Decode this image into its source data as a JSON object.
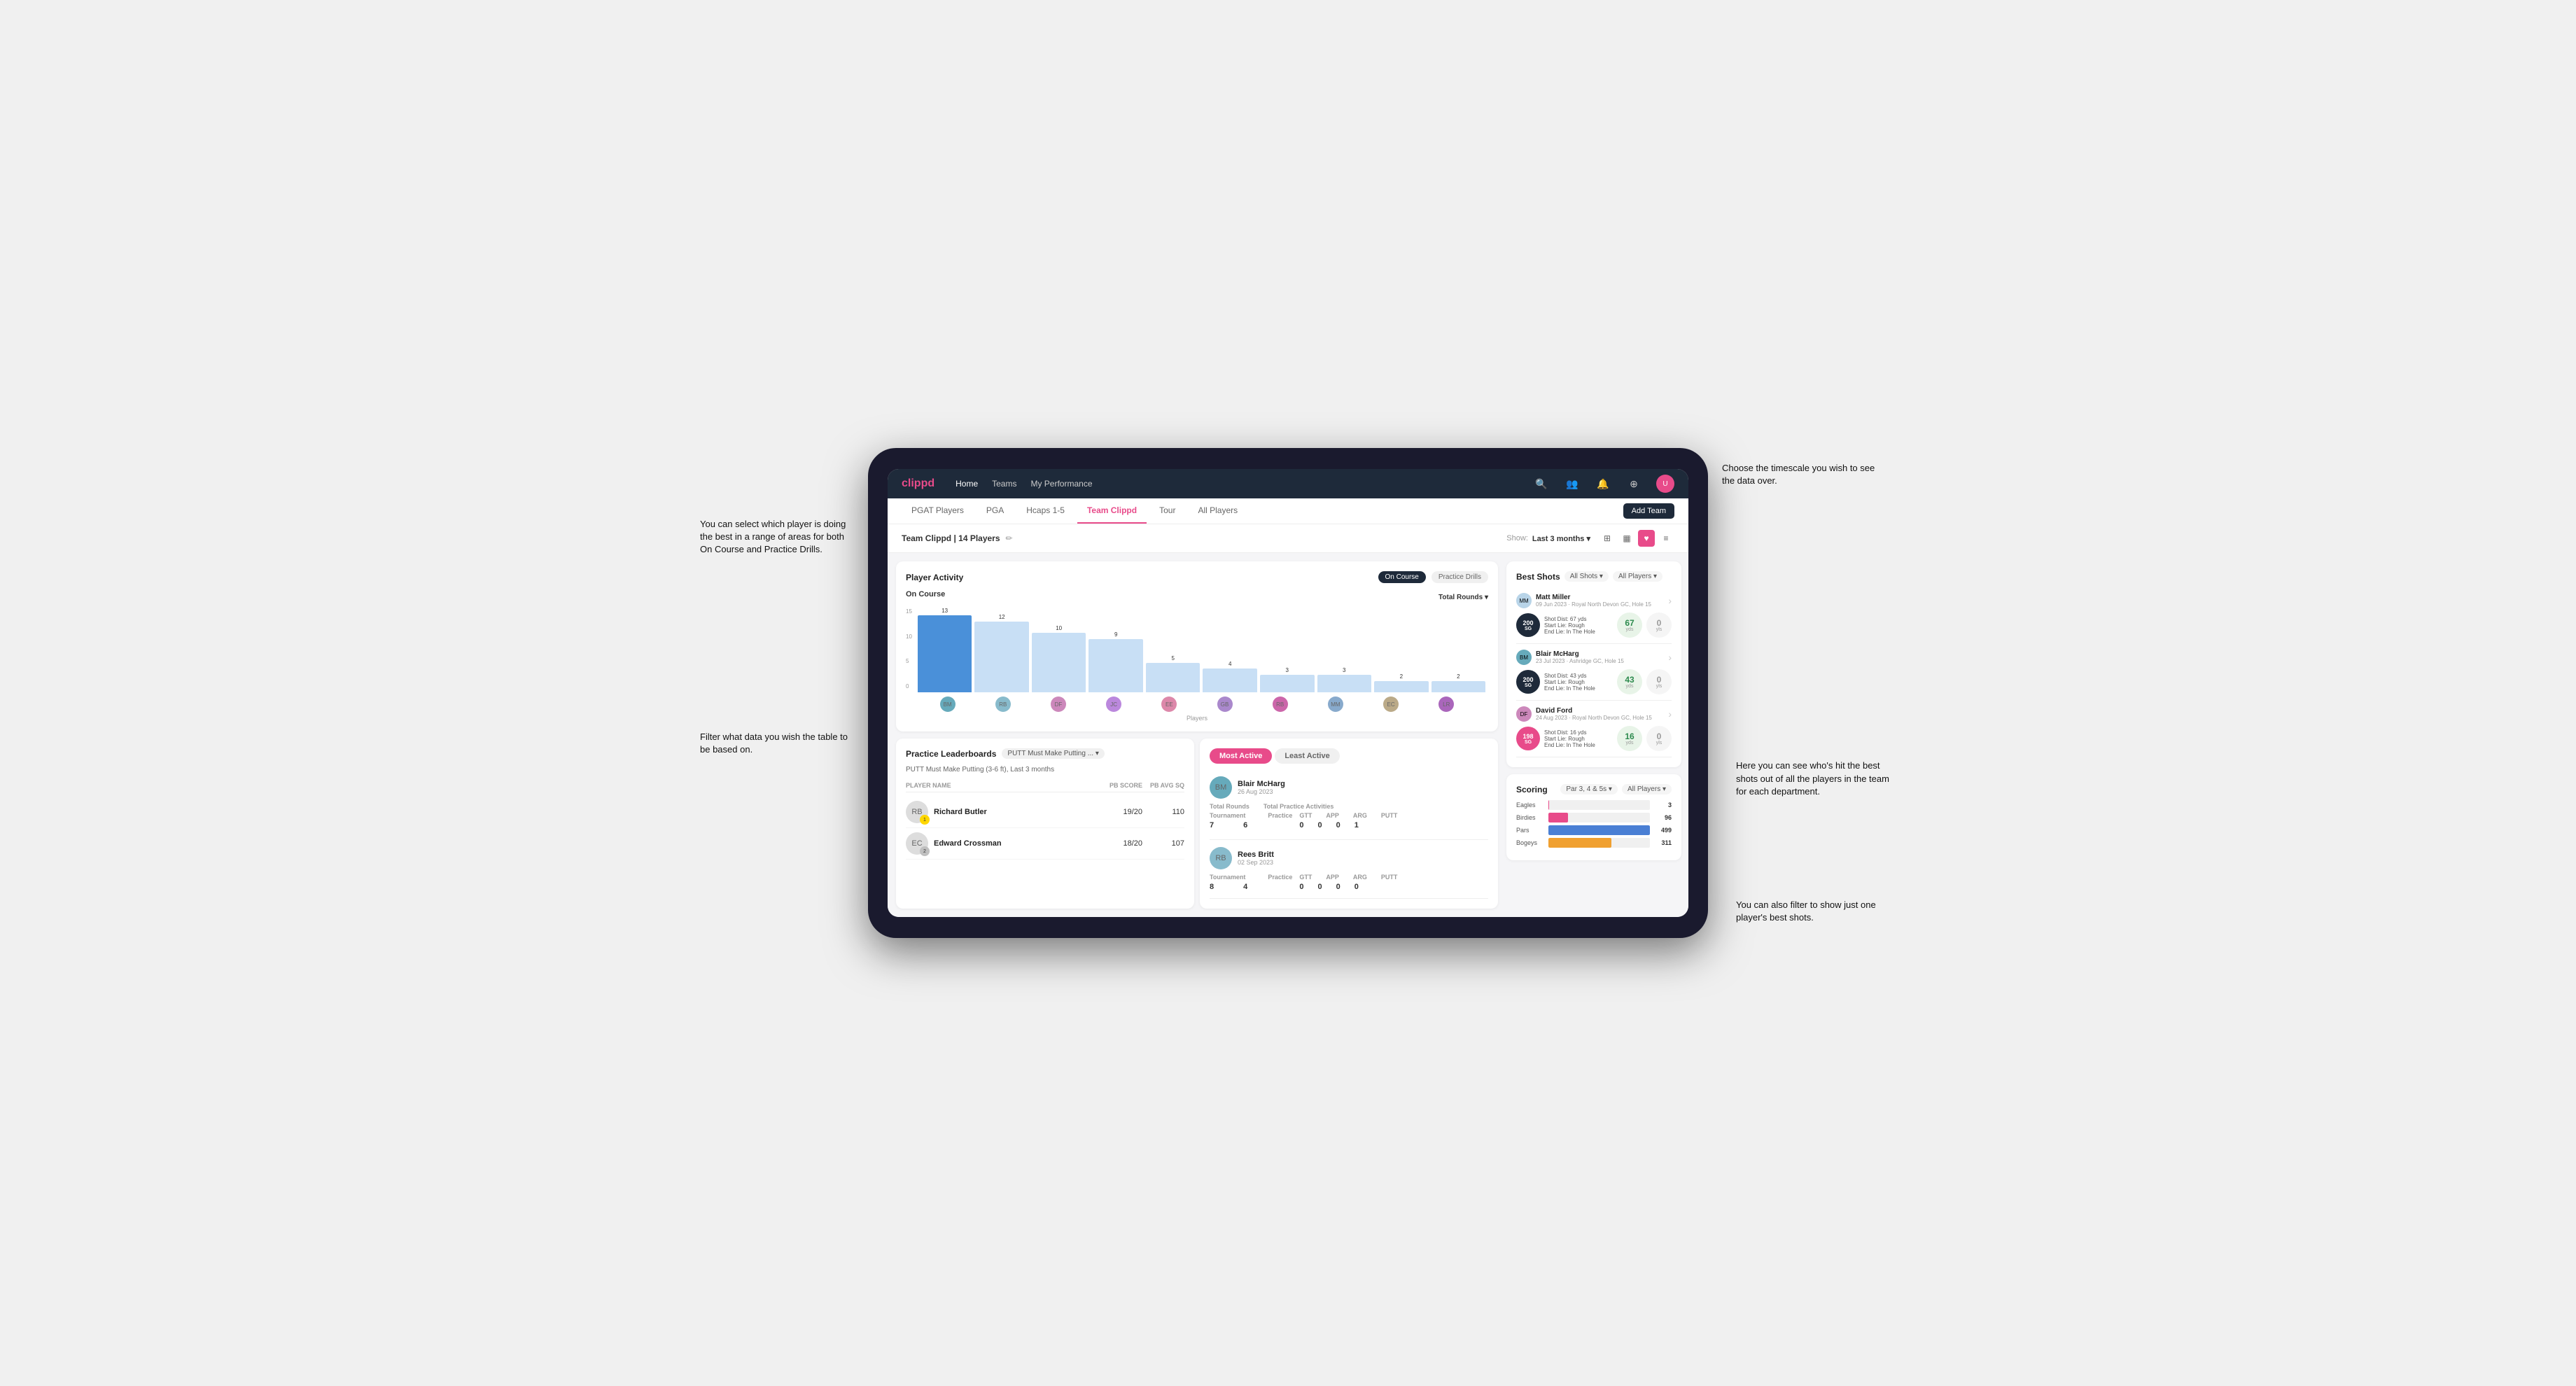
{
  "annotations": {
    "top_right": "Choose the timescale you\nwish to see the data over.",
    "mid_right": "Here you can see who's hit\nthe best shots out of all the\nplayers in the team for\neach department.",
    "bot_right": "You can also filter to show\njust one player's best shots.",
    "top_left": "You can select which player is\ndoing the best in a range of\nareas for both On Course and\nPractice Drills.",
    "bot_left": "Filter what data you wish the\ntable to be based on."
  },
  "nav": {
    "logo": "clippd",
    "links": [
      "Home",
      "Teams",
      "My Performance"
    ],
    "icons": [
      "search",
      "people",
      "bell",
      "plus-circle",
      "user"
    ]
  },
  "sub_tabs": {
    "tabs": [
      "PGAT Players",
      "PGA",
      "Hcaps 1-5",
      "Team Clippd",
      "Tour",
      "All Players"
    ],
    "active": "Team Clippd",
    "add_btn": "Add Team"
  },
  "team_header": {
    "title": "Team Clippd | 14 Players",
    "show_label": "Show:",
    "time_value": "Last 3 months",
    "view_icons": [
      "grid-4",
      "grid-2",
      "heart-fill",
      "filter"
    ]
  },
  "player_activity": {
    "title": "Player Activity",
    "toggle_left": "On Course",
    "toggle_right": "Practice Drills",
    "section": "On Course",
    "chart_dropdown": "Total Rounds",
    "bars": [
      {
        "player": "B. McHarg",
        "value": 13,
        "height": 100,
        "type": "highlight"
      },
      {
        "player": "R. Britt",
        "value": 12,
        "height": 92,
        "type": "normal"
      },
      {
        "player": "D. Ford",
        "value": 10,
        "height": 77,
        "type": "normal"
      },
      {
        "player": "J. Coles",
        "value": 9,
        "height": 69,
        "type": "normal"
      },
      {
        "player": "E. Ebert",
        "value": 5,
        "height": 38,
        "type": "normal"
      },
      {
        "player": "G. Billingham",
        "value": 4,
        "height": 31,
        "type": "normal"
      },
      {
        "player": "R. Butler",
        "value": 3,
        "height": 23,
        "type": "normal"
      },
      {
        "player": "M. Miller",
        "value": 3,
        "height": 23,
        "type": "normal"
      },
      {
        "player": "E. Crossman",
        "value": 2,
        "height": 15,
        "type": "normal"
      },
      {
        "player": "L. Robertson",
        "value": 2,
        "height": 15,
        "type": "normal"
      }
    ],
    "y_labels": [
      "15",
      "10",
      "5",
      "0"
    ],
    "x_label": "Players"
  },
  "practice_leaderboards": {
    "title": "Practice Leaderboards",
    "filter": "PUTT Must Make Putting ...",
    "subtitle": "PUTT Must Make Putting (3-6 ft), Last 3 months",
    "col_name": "PLAYER NAME",
    "col_score": "PB SCORE",
    "col_avg": "PB AVG SQ",
    "players": [
      {
        "name": "Richard Butler",
        "score": "19/20",
        "avg": "110",
        "rank": 1
      },
      {
        "name": "Edward Crossman",
        "score": "18/20",
        "avg": "107",
        "rank": 2
      }
    ]
  },
  "most_active": {
    "tabs": [
      "Most Active",
      "Least Active"
    ],
    "players": [
      {
        "name": "Blair McHarg",
        "date": "26 Aug 2023",
        "rounds_tournament": "7",
        "rounds_practice": "6",
        "gtt": "0",
        "app": "0",
        "arg": "0",
        "putt": "1"
      },
      {
        "name": "Rees Britt",
        "date": "02 Sep 2023",
        "rounds_tournament": "8",
        "rounds_practice": "4",
        "gtt": "0",
        "app": "0",
        "arg": "0",
        "putt": "0"
      }
    ]
  },
  "best_shots": {
    "title": "Best Shots",
    "filter1": "All Shots",
    "filter2": "All Players",
    "shots": [
      {
        "player": "Matt Miller",
        "date": "09 Jun 2023",
        "course": "Royal North Devon GC",
        "hole": "Hole 15",
        "badge": "200\nSG",
        "dist_text": "Shot Dist: 67 yds\nStart Lie: Rough\nEnd Lie: In The Hole",
        "dist_val": "67",
        "dist_unit": "yds",
        "zero_val": "0",
        "zero_unit": "yls"
      },
      {
        "player": "Blair McHarg",
        "date": "23 Jul 2023",
        "course": "Ashridge GC",
        "hole": "Hole 15",
        "badge": "200\nSG",
        "dist_text": "Shot Dist: 43 yds\nStart Lie: Rough\nEnd Lie: In The Hole",
        "dist_val": "43",
        "dist_unit": "yds",
        "zero_val": "0",
        "zero_unit": "yls"
      },
      {
        "player": "David Ford",
        "date": "24 Aug 2023",
        "course": "Royal North Devon GC",
        "hole": "Hole 15",
        "badge": "198\nSG",
        "dist_text": "Shot Dist: 16 yds\nStart Lie: Rough\nEnd Lie: In The Hole",
        "dist_val": "16",
        "dist_unit": "yds",
        "zero_val": "0",
        "zero_unit": "yls"
      }
    ]
  },
  "scoring": {
    "title": "Scoring",
    "filter1": "Par 3, 4 & 5s",
    "filter2": "All Players",
    "rows": [
      {
        "label": "Eagles",
        "value": 3,
        "max": 500,
        "color": "eagles"
      },
      {
        "label": "Birdies",
        "value": 96,
        "max": 500,
        "color": "birdies"
      },
      {
        "label": "Pars",
        "value": 499,
        "max": 500,
        "color": "pars"
      },
      {
        "label": "Bogeys",
        "value": 311,
        "max": 500,
        "color": "bogeys"
      }
    ]
  }
}
